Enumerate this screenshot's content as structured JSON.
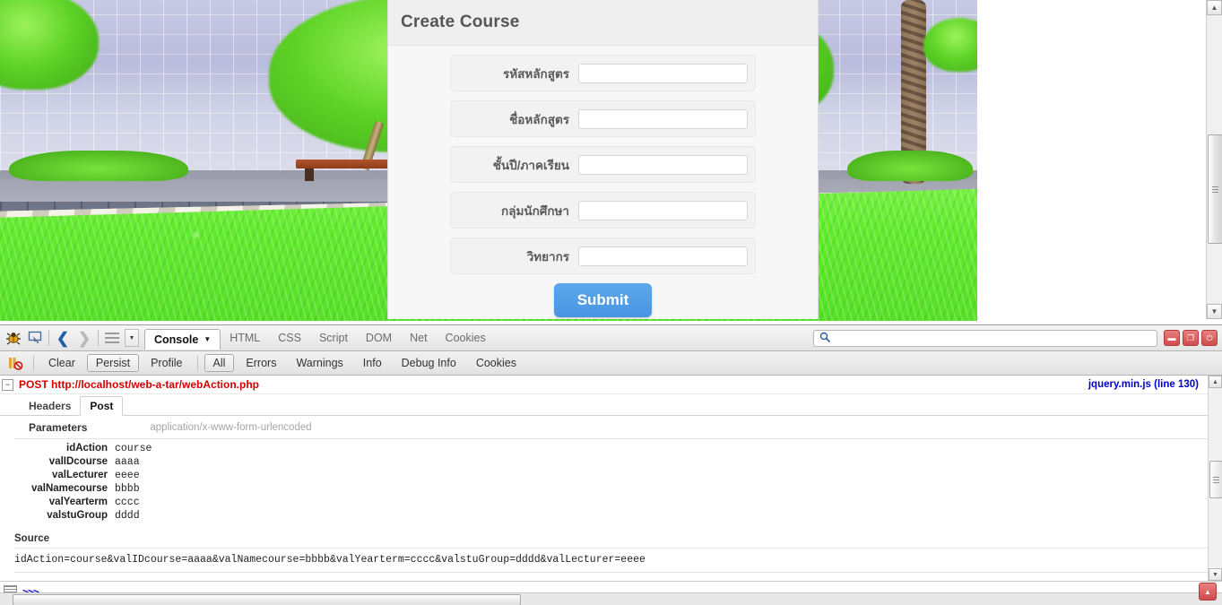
{
  "page": {
    "background_photo_alt": "campus-building-photo"
  },
  "course_form": {
    "title": "Create Course",
    "fields": [
      {
        "label": "รหัสหลักสูตร",
        "value": "",
        "name": "valIDcourse"
      },
      {
        "label": "ชื่อหลักสูตร",
        "value": "",
        "name": "valNamecourse"
      },
      {
        "label": "ชั้นปี/ภาคเรียน",
        "value": "",
        "name": "valYearterm"
      },
      {
        "label": "กลุ่มนักศึกษา",
        "value": "",
        "name": "valstuGroup"
      },
      {
        "label": "วิทยากร",
        "value": "",
        "name": "valLecturer"
      }
    ],
    "submit_label": "Submit"
  },
  "firebug": {
    "panels": [
      {
        "label": "Console",
        "active": true,
        "has_caret": true
      },
      {
        "label": "HTML",
        "active": false
      },
      {
        "label": "CSS",
        "active": false
      },
      {
        "label": "Script",
        "active": false
      },
      {
        "label": "DOM",
        "active": false
      },
      {
        "label": "Net",
        "active": false
      },
      {
        "label": "Cookies",
        "active": false
      }
    ],
    "search": {
      "placeholder": "",
      "value": ""
    },
    "window_buttons": [
      "minimize",
      "restore",
      "close"
    ],
    "console_filters": [
      {
        "label": "Clear",
        "boxed": false
      },
      {
        "label": "Persist",
        "boxed": true
      },
      {
        "label": "Profile",
        "boxed": false
      },
      {
        "label": "All",
        "boxed": true
      },
      {
        "label": "Errors",
        "boxed": false
      },
      {
        "label": "Warnings",
        "boxed": false
      },
      {
        "label": "Info",
        "boxed": false
      },
      {
        "label": "Debug Info",
        "boxed": false
      },
      {
        "label": "Cookies",
        "boxed": false
      }
    ],
    "request": {
      "method_and_url": "POST http://localhost/web-a-tar/webAction.php",
      "source_file": "jquery.min.js (line 130)",
      "twisty": "−",
      "detail_tabs": [
        {
          "label": "Headers",
          "active": false
        },
        {
          "label": "Post",
          "active": true
        }
      ],
      "parameters_label": "Parameters",
      "content_type": "application/x-www-form-urlencoded",
      "parameters": [
        {
          "name": "idAction",
          "value": "course"
        },
        {
          "name": "valIDcourse",
          "value": "aaaa"
        },
        {
          "name": "valLecturer",
          "value": "eeee"
        },
        {
          "name": "valNamecourse",
          "value": "bbbb"
        },
        {
          "name": "valYearterm",
          "value": "cccc"
        },
        {
          "name": "valstuGroup",
          "value": "dddd"
        }
      ],
      "source_label": "Source",
      "source_text": "idAction=course&valIDcourse=aaaa&valNamecourse=bbbb&valYearterm=cccc&valstuGroup=dddd&valLecturer=eeee"
    },
    "command_prompt": ">>>",
    "command_value": ""
  },
  "colors": {
    "submit_blue": "#4a95e2",
    "post_red": "#d40000",
    "link_blue": "#0000cc",
    "panel_bg": "#f7f7f7"
  }
}
